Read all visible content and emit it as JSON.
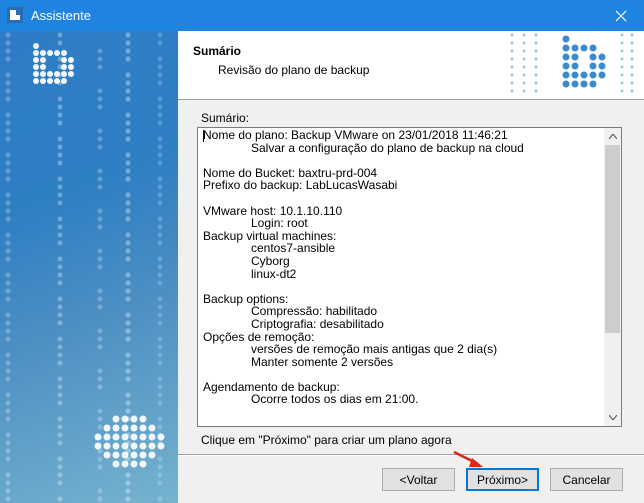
{
  "window": {
    "title": "Assistente",
    "accent": "#1f83e0"
  },
  "header": {
    "title": "Sumário",
    "subtitle": "Revisão do plano de backup"
  },
  "summary": {
    "label": "Sumário:",
    "lines": [
      {
        "text": "Nome do plano: Backup VMware on 23/01/2018 11:46:21",
        "indent": false
      },
      {
        "text": "Salvar a configuração do plano de backup na cloud",
        "indent": true
      },
      {
        "text": "",
        "indent": false
      },
      {
        "text": "Nome do Bucket: baxtru-prd-004",
        "indent": false
      },
      {
        "text": "Prefixo do backup: LabLucasWasabi",
        "indent": false
      },
      {
        "text": "",
        "indent": false
      },
      {
        "text": "VMware host: 10.1.10.110",
        "indent": false
      },
      {
        "text": "Login: root",
        "indent": true
      },
      {
        "text": "Backup virtual machines:",
        "indent": false
      },
      {
        "text": "centos7-ansible",
        "indent": true
      },
      {
        "text": "Cyborg",
        "indent": true
      },
      {
        "text": "linux-dt2",
        "indent": true
      },
      {
        "text": "",
        "indent": false
      },
      {
        "text": "Backup options:",
        "indent": false
      },
      {
        "text": "Compressão: habilitado",
        "indent": true
      },
      {
        "text": "Criptografia: desabilitado",
        "indent": true
      },
      {
        "text": "Opções de remoção:",
        "indent": false
      },
      {
        "text": "versões de remoção mais antigas que 2 dia(s)",
        "indent": true
      },
      {
        "text": "Manter somente 2 versões",
        "indent": true
      },
      {
        "text": "",
        "indent": false
      },
      {
        "text": "Agendamento de backup:",
        "indent": false
      },
      {
        "text": "Ocorre todos os dias em 21:00.",
        "indent": true
      }
    ]
  },
  "hint": "Clique em \"Próximo\" para criar um plano agora",
  "buttons": {
    "back": "<Voltar",
    "next": "Próximo>",
    "cancel": "Cancelar"
  }
}
